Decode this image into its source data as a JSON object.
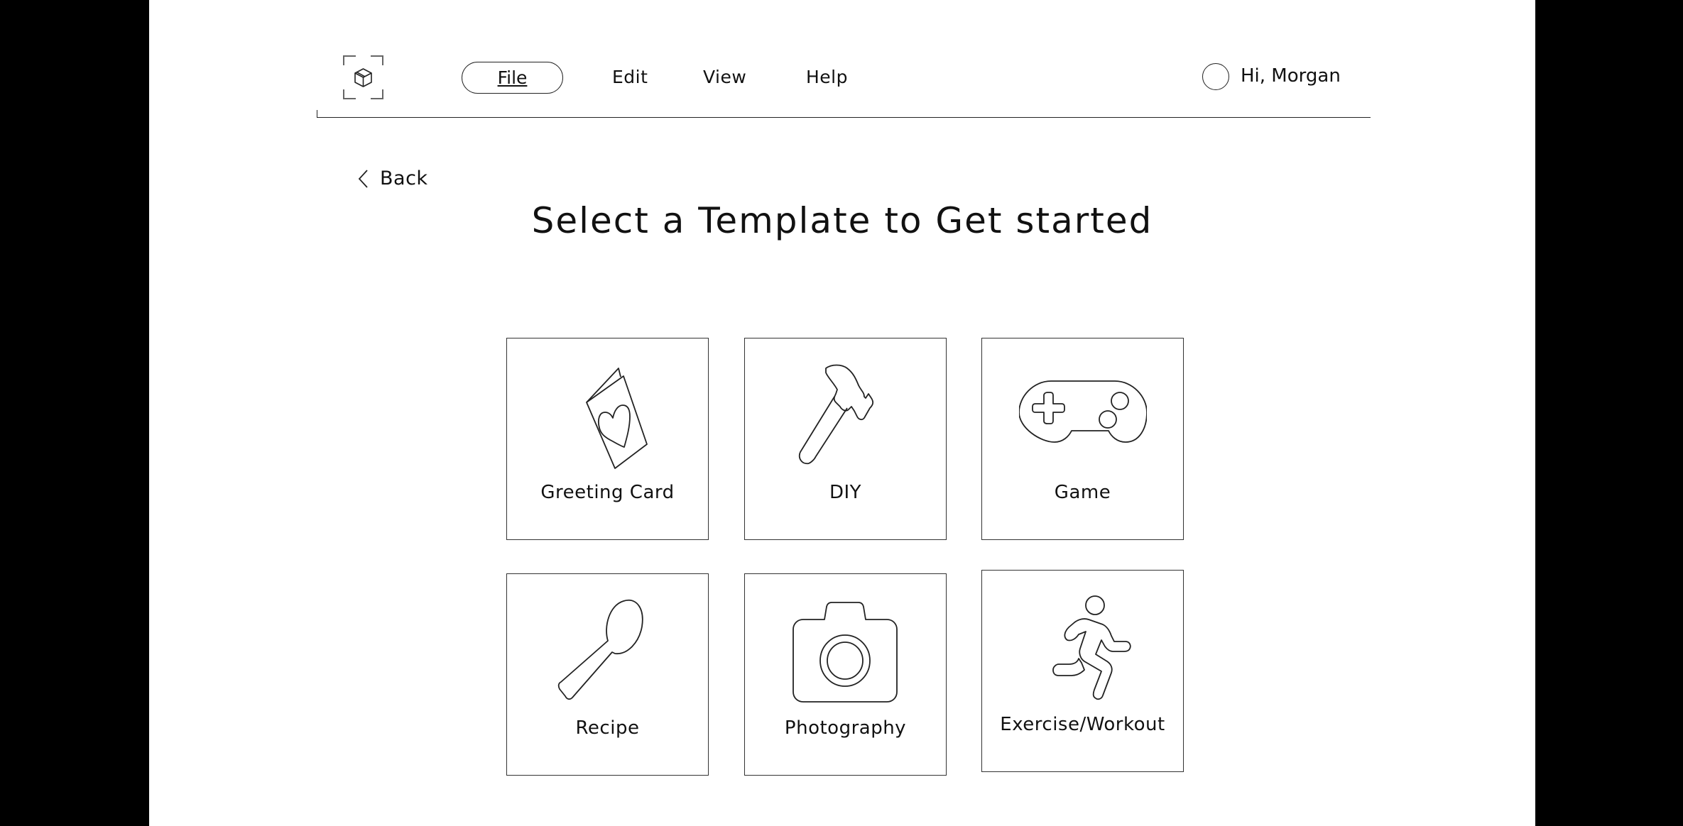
{
  "app": {
    "logo_icon": "cube-icon"
  },
  "nav": {
    "items": [
      {
        "label": "File",
        "active": true
      },
      {
        "label": "Edit",
        "active": false
      },
      {
        "label": "View",
        "active": false
      },
      {
        "label": "Help",
        "active": false
      }
    ]
  },
  "user": {
    "greeting": "Hi, Morgan",
    "avatar_icon": "avatar-circle"
  },
  "back": {
    "label": "Back",
    "icon": "chevron-left-icon"
  },
  "page": {
    "title": "Select a Template to Get started"
  },
  "templates": [
    {
      "label": "Greeting Card",
      "icon": "greeting-card-icon"
    },
    {
      "label": "DIY",
      "icon": "hammer-icon"
    },
    {
      "label": "Game",
      "icon": "gamepad-icon"
    },
    {
      "label": "Recipe",
      "icon": "spoon-icon"
    },
    {
      "label": "Photography",
      "icon": "camera-icon"
    },
    {
      "label": "Exercise/Workout",
      "icon": "running-person-icon"
    }
  ]
}
